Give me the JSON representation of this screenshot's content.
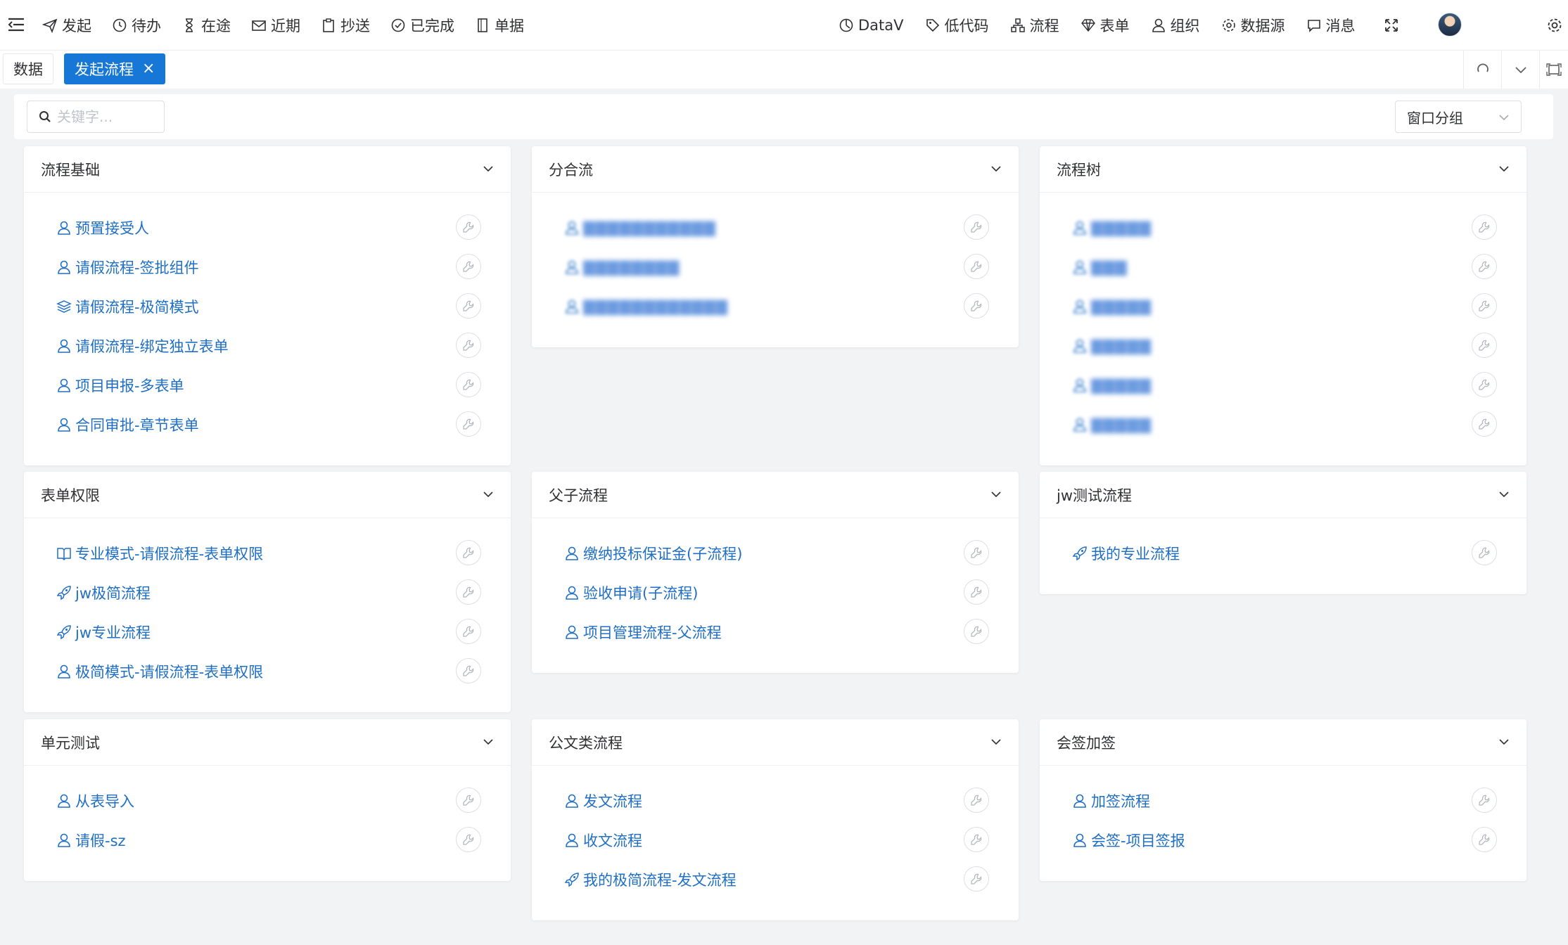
{
  "topnav": {
    "left_items": [
      {
        "label": "发起",
        "icon": "send-icon"
      },
      {
        "label": "待办",
        "icon": "clock-icon"
      },
      {
        "label": "在途",
        "icon": "hourglass-icon"
      },
      {
        "label": "近期",
        "icon": "mail-icon"
      },
      {
        "label": "抄送",
        "icon": "clipboard-icon"
      },
      {
        "label": "已完成",
        "icon": "check-circle-icon"
      },
      {
        "label": "单据",
        "icon": "document-icon"
      }
    ],
    "right_items": [
      {
        "label": "DataV",
        "icon": "dashboard-icon"
      },
      {
        "label": "低代码",
        "icon": "tag-icon"
      },
      {
        "label": "流程",
        "icon": "flow-icon"
      },
      {
        "label": "表单",
        "icon": "diamond-icon"
      },
      {
        "label": "组织",
        "icon": "user-icon"
      },
      {
        "label": "数据源",
        "icon": "gear-icon"
      },
      {
        "label": "消息",
        "icon": "chat-icon"
      }
    ]
  },
  "tabs": [
    {
      "label": "数据",
      "active": false
    },
    {
      "label": "发起流程",
      "active": true,
      "close": "×"
    }
  ],
  "search": {
    "placeholder": "关键字..."
  },
  "group_select": {
    "value": "窗口分组"
  },
  "colors": {
    "link": "#1f6fc5",
    "accent": "#1677d6"
  },
  "groups": [
    {
      "title": "流程基础",
      "items": [
        {
          "label": "预置接受人",
          "icon": "user-icon"
        },
        {
          "label": "请假流程-签批组件",
          "icon": "user-icon"
        },
        {
          "label": "请假流程-极简模式",
          "icon": "layers-icon"
        },
        {
          "label": "请假流程-绑定独立表单",
          "icon": "user-icon"
        },
        {
          "label": "项目申报-多表单",
          "icon": "user-icon"
        },
        {
          "label": "合同审批-章节表单",
          "icon": "user-icon"
        }
      ]
    },
    {
      "title": "分合流",
      "items": [
        {
          "label": "▇▇▇▇▇▇▇▇▇▇▇",
          "icon": "user-icon",
          "blurred": true
        },
        {
          "label": "▇▇▇▇▇▇▇▇",
          "icon": "user-icon",
          "blurred": true
        },
        {
          "label": "▇▇▇▇▇▇▇▇▇▇▇▇",
          "icon": "user-icon",
          "blurred": true
        }
      ]
    },
    {
      "title": "流程树",
      "items": [
        {
          "label": "▇▇▇▇▇",
          "icon": "user-icon",
          "blurred": true
        },
        {
          "label": "▇▇▇",
          "icon": "user-icon",
          "blurred": true
        },
        {
          "label": "▇▇▇▇▇",
          "icon": "user-icon",
          "blurred": true
        },
        {
          "label": "▇▇▇▇▇",
          "icon": "user-icon",
          "blurred": true
        },
        {
          "label": "▇▇▇▇▇",
          "icon": "user-icon",
          "blurred": true
        },
        {
          "label": "▇▇▇▇▇",
          "icon": "user-icon",
          "blurred": true
        }
      ]
    },
    {
      "title": "表单权限",
      "items": [
        {
          "label": "专业模式-请假流程-表单权限",
          "icon": "book-icon"
        },
        {
          "label": "jw极简流程",
          "icon": "rocket-icon"
        },
        {
          "label": "jw专业流程",
          "icon": "rocket-icon"
        },
        {
          "label": "极简模式-请假流程-表单权限",
          "icon": "user-icon"
        }
      ]
    },
    {
      "title": "父子流程",
      "items": [
        {
          "label": "缴纳投标保证金(子流程)",
          "icon": "user-icon"
        },
        {
          "label": "验收申请(子流程)",
          "icon": "user-icon"
        },
        {
          "label": "项目管理流程-父流程",
          "icon": "user-icon"
        }
      ]
    },
    {
      "title": "jw测试流程",
      "items": [
        {
          "label": "我的专业流程",
          "icon": "rocket-icon"
        }
      ]
    },
    {
      "title": "单元测试",
      "items": [
        {
          "label": "从表导入",
          "icon": "user-icon"
        },
        {
          "label": "请假-sz",
          "icon": "user-icon"
        }
      ]
    },
    {
      "title": "公文类流程",
      "items": [
        {
          "label": "发文流程",
          "icon": "user-icon"
        },
        {
          "label": "收文流程",
          "icon": "user-icon"
        },
        {
          "label": "我的极简流程-发文流程",
          "icon": "rocket-icon"
        }
      ]
    },
    {
      "title": "会签加签",
      "items": [
        {
          "label": "加签流程",
          "icon": "user-icon"
        },
        {
          "label": "会签-项目签报",
          "icon": "user-icon"
        }
      ]
    }
  ]
}
